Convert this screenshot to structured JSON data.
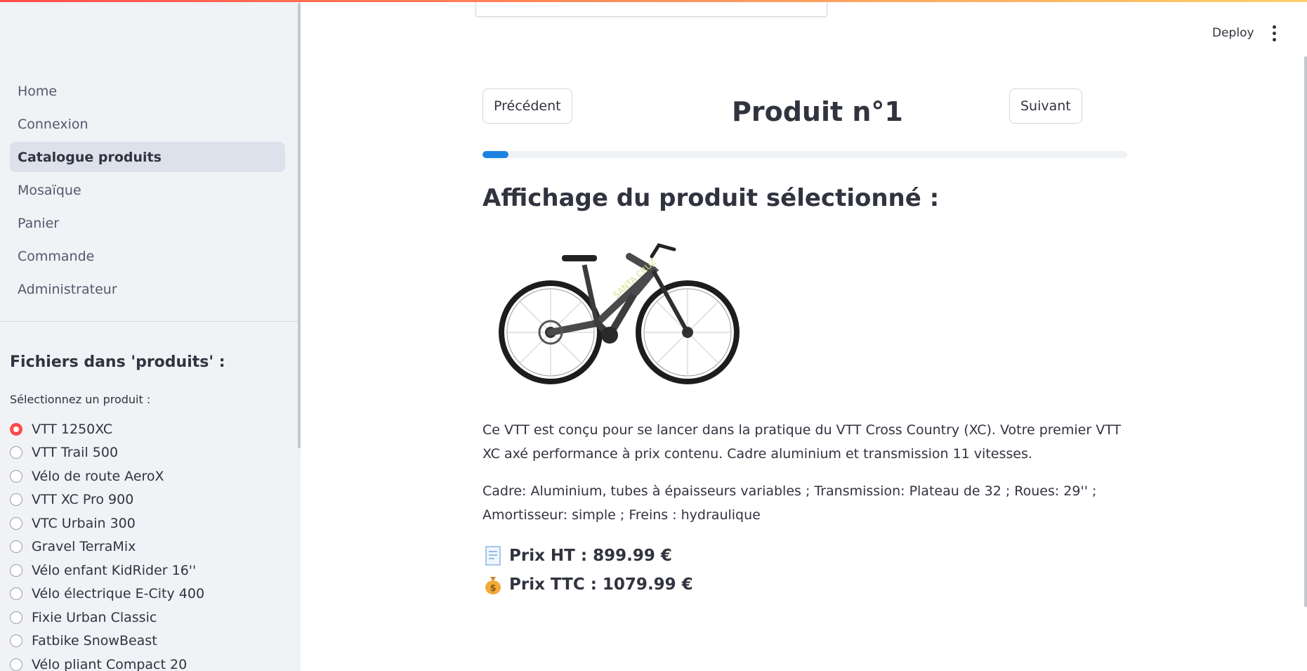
{
  "header": {
    "deploy_label": "Deploy",
    "menu_icon": "more-vertical-icon"
  },
  "sidebar": {
    "nav_items": [
      {
        "label": "Home",
        "active": false
      },
      {
        "label": "Connexion",
        "active": false
      },
      {
        "label": "Catalogue produits",
        "active": true
      },
      {
        "label": "Mosaïque",
        "active": false
      },
      {
        "label": "Panier",
        "active": false
      },
      {
        "label": "Commande",
        "active": false
      },
      {
        "label": "Administrateur",
        "active": false
      }
    ],
    "files_title": "Fichiers dans 'produits' :",
    "select_label": "Sélectionnez un produit :",
    "products": [
      {
        "label": "VTT 1250XC",
        "selected": true
      },
      {
        "label": "VTT Trail 500",
        "selected": false
      },
      {
        "label": "Vélo de route AeroX",
        "selected": false
      },
      {
        "label": "VTT XC Pro 900",
        "selected": false
      },
      {
        "label": "VTC Urbain 300",
        "selected": false
      },
      {
        "label": "Gravel TerraMix",
        "selected": false
      },
      {
        "label": "Vélo enfant KidRider 16''",
        "selected": false
      },
      {
        "label": "Vélo électrique E-City 400",
        "selected": false
      },
      {
        "label": "Fixie Urban Classic",
        "selected": false
      },
      {
        "label": "Fatbike SnowBeast",
        "selected": false
      },
      {
        "label": "Vélo pliant Compact 20",
        "selected": false
      }
    ]
  },
  "main": {
    "prev_label": "Précédent",
    "next_label": "Suivant",
    "product_title": "Produit n°1",
    "progress": 0.04,
    "section_title": "Affichage du produit sélectionné :",
    "description": "Ce VTT est conçu pour se lancer dans la pratique du VTT Cross Country (XC). Votre premier VTT XC axé performance à prix contenu. Cadre aluminium et transmission 11 vitesses.",
    "specs": "Cadre: Aluminium, tubes à épaisseurs variables ; Transmission: Plateau de 32 ; Roues: 29'' ; Amortisseur: simple ; Freins : hydraulique",
    "price_ht": "Prix HT : 899.99 €",
    "price_ttc": "Prix TTC : 1079.99 €",
    "price_ht_icon": "receipt-icon",
    "price_ttc_icon": "money-bag-icon"
  },
  "colors": {
    "accent": "#ff4b4b",
    "progress": "#1c83e1",
    "sidebar_bg": "#f0f2f6",
    "active_nav": "#dde1ec"
  }
}
